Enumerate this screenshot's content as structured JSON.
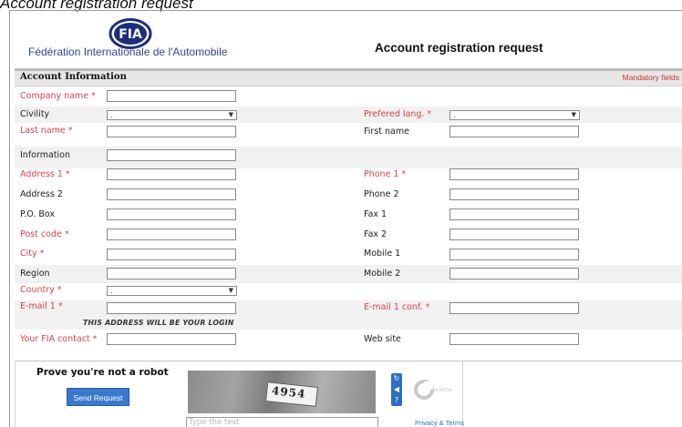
{
  "caption": "Account registration request",
  "header": {
    "org_name": "Fédération Internationale de l'Automobile",
    "title": "Account registration request"
  },
  "section": {
    "title": "Account Information",
    "mandatory": "Mandatory fields"
  },
  "fields_left": [
    {
      "label": "Company name *",
      "required": true,
      "type": "text"
    },
    {
      "label": "Civility",
      "required": false,
      "type": "select",
      "value": "."
    },
    {
      "label": "Last name *",
      "required": true,
      "type": "text"
    },
    {
      "label": "Information",
      "required": false,
      "type": "text"
    },
    {
      "label": "Address 1 *",
      "required": true,
      "type": "text"
    },
    {
      "label": "Address 2",
      "required": false,
      "type": "text"
    },
    {
      "label": "P.O. Box",
      "required": false,
      "type": "text"
    },
    {
      "label": "Post code *",
      "required": true,
      "type": "text"
    },
    {
      "label": "City *",
      "required": true,
      "type": "text"
    },
    {
      "label": "Region",
      "required": false,
      "type": "text"
    },
    {
      "label": "Country *",
      "required": true,
      "type": "select",
      "value": "."
    },
    {
      "label": "E-mail 1 *",
      "required": true,
      "type": "text"
    },
    {
      "label": "Your FIA contact *",
      "required": true,
      "type": "text"
    }
  ],
  "fields_right": [
    {
      "label": "Prefered lang. *",
      "required": true,
      "type": "select",
      "value": "."
    },
    {
      "label": "First name",
      "required": false,
      "type": "text"
    },
    {
      "label": "Phone 1 *",
      "required": true,
      "type": "text"
    },
    {
      "label": "Phone 2",
      "required": false,
      "type": "text"
    },
    {
      "label": "Fax 1",
      "required": false,
      "type": "text"
    },
    {
      "label": "Fax 2",
      "required": false,
      "type": "text"
    },
    {
      "label": "Mobile 1",
      "required": false,
      "type": "text"
    },
    {
      "label": "Mobile 2",
      "required": false,
      "type": "text"
    },
    {
      "label": "E-mail 1 conf. *",
      "required": true,
      "type": "text"
    },
    {
      "label": "Web site",
      "required": false,
      "type": "text"
    }
  ],
  "login_note": "THIS ADDRESS WILL BE YOUR LOGIN",
  "captcha": {
    "title": "Prove you're not a robot",
    "send_label": "Send Request",
    "image_text": "4954",
    "input_placeholder": "Type the text",
    "privacy": "Privacy & Terms",
    "icons": [
      "refresh-icon",
      "audio-icon",
      "help-icon"
    ]
  },
  "colors": {
    "required": "#e0414b",
    "button": "#3a78cd",
    "org_text": "#33449a"
  }
}
